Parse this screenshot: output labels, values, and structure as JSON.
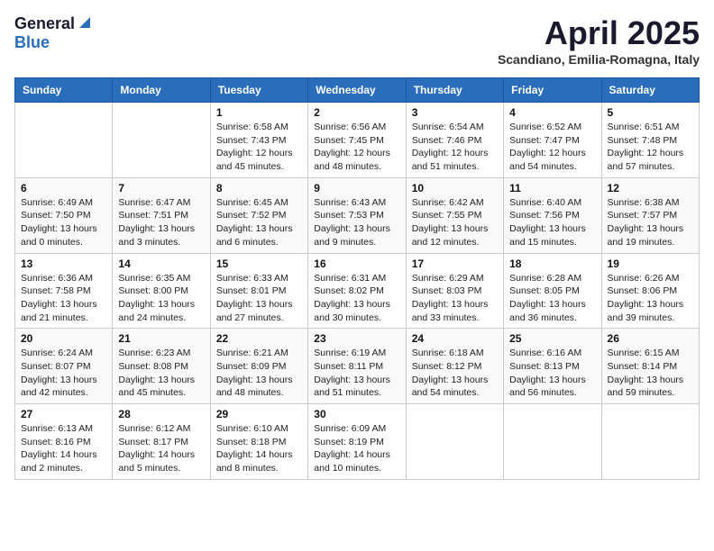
{
  "logo": {
    "general": "General",
    "blue": "Blue"
  },
  "title": "April 2025",
  "subtitle": "Scandiano, Emilia-Romagna, Italy",
  "headers": [
    "Sunday",
    "Monday",
    "Tuesday",
    "Wednesday",
    "Thursday",
    "Friday",
    "Saturday"
  ],
  "weeks": [
    [
      {
        "day": "",
        "detail": ""
      },
      {
        "day": "",
        "detail": ""
      },
      {
        "day": "1",
        "detail": "Sunrise: 6:58 AM\nSunset: 7:43 PM\nDaylight: 12 hours\nand 45 minutes."
      },
      {
        "day": "2",
        "detail": "Sunrise: 6:56 AM\nSunset: 7:45 PM\nDaylight: 12 hours\nand 48 minutes."
      },
      {
        "day": "3",
        "detail": "Sunrise: 6:54 AM\nSunset: 7:46 PM\nDaylight: 12 hours\nand 51 minutes."
      },
      {
        "day": "4",
        "detail": "Sunrise: 6:52 AM\nSunset: 7:47 PM\nDaylight: 12 hours\nand 54 minutes."
      },
      {
        "day": "5",
        "detail": "Sunrise: 6:51 AM\nSunset: 7:48 PM\nDaylight: 12 hours\nand 57 minutes."
      }
    ],
    [
      {
        "day": "6",
        "detail": "Sunrise: 6:49 AM\nSunset: 7:50 PM\nDaylight: 13 hours\nand 0 minutes."
      },
      {
        "day": "7",
        "detail": "Sunrise: 6:47 AM\nSunset: 7:51 PM\nDaylight: 13 hours\nand 3 minutes."
      },
      {
        "day": "8",
        "detail": "Sunrise: 6:45 AM\nSunset: 7:52 PM\nDaylight: 13 hours\nand 6 minutes."
      },
      {
        "day": "9",
        "detail": "Sunrise: 6:43 AM\nSunset: 7:53 PM\nDaylight: 13 hours\nand 9 minutes."
      },
      {
        "day": "10",
        "detail": "Sunrise: 6:42 AM\nSunset: 7:55 PM\nDaylight: 13 hours\nand 12 minutes."
      },
      {
        "day": "11",
        "detail": "Sunrise: 6:40 AM\nSunset: 7:56 PM\nDaylight: 13 hours\nand 15 minutes."
      },
      {
        "day": "12",
        "detail": "Sunrise: 6:38 AM\nSunset: 7:57 PM\nDaylight: 13 hours\nand 19 minutes."
      }
    ],
    [
      {
        "day": "13",
        "detail": "Sunrise: 6:36 AM\nSunset: 7:58 PM\nDaylight: 13 hours\nand 21 minutes."
      },
      {
        "day": "14",
        "detail": "Sunrise: 6:35 AM\nSunset: 8:00 PM\nDaylight: 13 hours\nand 24 minutes."
      },
      {
        "day": "15",
        "detail": "Sunrise: 6:33 AM\nSunset: 8:01 PM\nDaylight: 13 hours\nand 27 minutes."
      },
      {
        "day": "16",
        "detail": "Sunrise: 6:31 AM\nSunset: 8:02 PM\nDaylight: 13 hours\nand 30 minutes."
      },
      {
        "day": "17",
        "detail": "Sunrise: 6:29 AM\nSunset: 8:03 PM\nDaylight: 13 hours\nand 33 minutes."
      },
      {
        "day": "18",
        "detail": "Sunrise: 6:28 AM\nSunset: 8:05 PM\nDaylight: 13 hours\nand 36 minutes."
      },
      {
        "day": "19",
        "detail": "Sunrise: 6:26 AM\nSunset: 8:06 PM\nDaylight: 13 hours\nand 39 minutes."
      }
    ],
    [
      {
        "day": "20",
        "detail": "Sunrise: 6:24 AM\nSunset: 8:07 PM\nDaylight: 13 hours\nand 42 minutes."
      },
      {
        "day": "21",
        "detail": "Sunrise: 6:23 AM\nSunset: 8:08 PM\nDaylight: 13 hours\nand 45 minutes."
      },
      {
        "day": "22",
        "detail": "Sunrise: 6:21 AM\nSunset: 8:09 PM\nDaylight: 13 hours\nand 48 minutes."
      },
      {
        "day": "23",
        "detail": "Sunrise: 6:19 AM\nSunset: 8:11 PM\nDaylight: 13 hours\nand 51 minutes."
      },
      {
        "day": "24",
        "detail": "Sunrise: 6:18 AM\nSunset: 8:12 PM\nDaylight: 13 hours\nand 54 minutes."
      },
      {
        "day": "25",
        "detail": "Sunrise: 6:16 AM\nSunset: 8:13 PM\nDaylight: 13 hours\nand 56 minutes."
      },
      {
        "day": "26",
        "detail": "Sunrise: 6:15 AM\nSunset: 8:14 PM\nDaylight: 13 hours\nand 59 minutes."
      }
    ],
    [
      {
        "day": "27",
        "detail": "Sunrise: 6:13 AM\nSunset: 8:16 PM\nDaylight: 14 hours\nand 2 minutes."
      },
      {
        "day": "28",
        "detail": "Sunrise: 6:12 AM\nSunset: 8:17 PM\nDaylight: 14 hours\nand 5 minutes."
      },
      {
        "day": "29",
        "detail": "Sunrise: 6:10 AM\nSunset: 8:18 PM\nDaylight: 14 hours\nand 8 minutes."
      },
      {
        "day": "30",
        "detail": "Sunrise: 6:09 AM\nSunset: 8:19 PM\nDaylight: 14 hours\nand 10 minutes."
      },
      {
        "day": "",
        "detail": ""
      },
      {
        "day": "",
        "detail": ""
      },
      {
        "day": "",
        "detail": ""
      }
    ]
  ]
}
